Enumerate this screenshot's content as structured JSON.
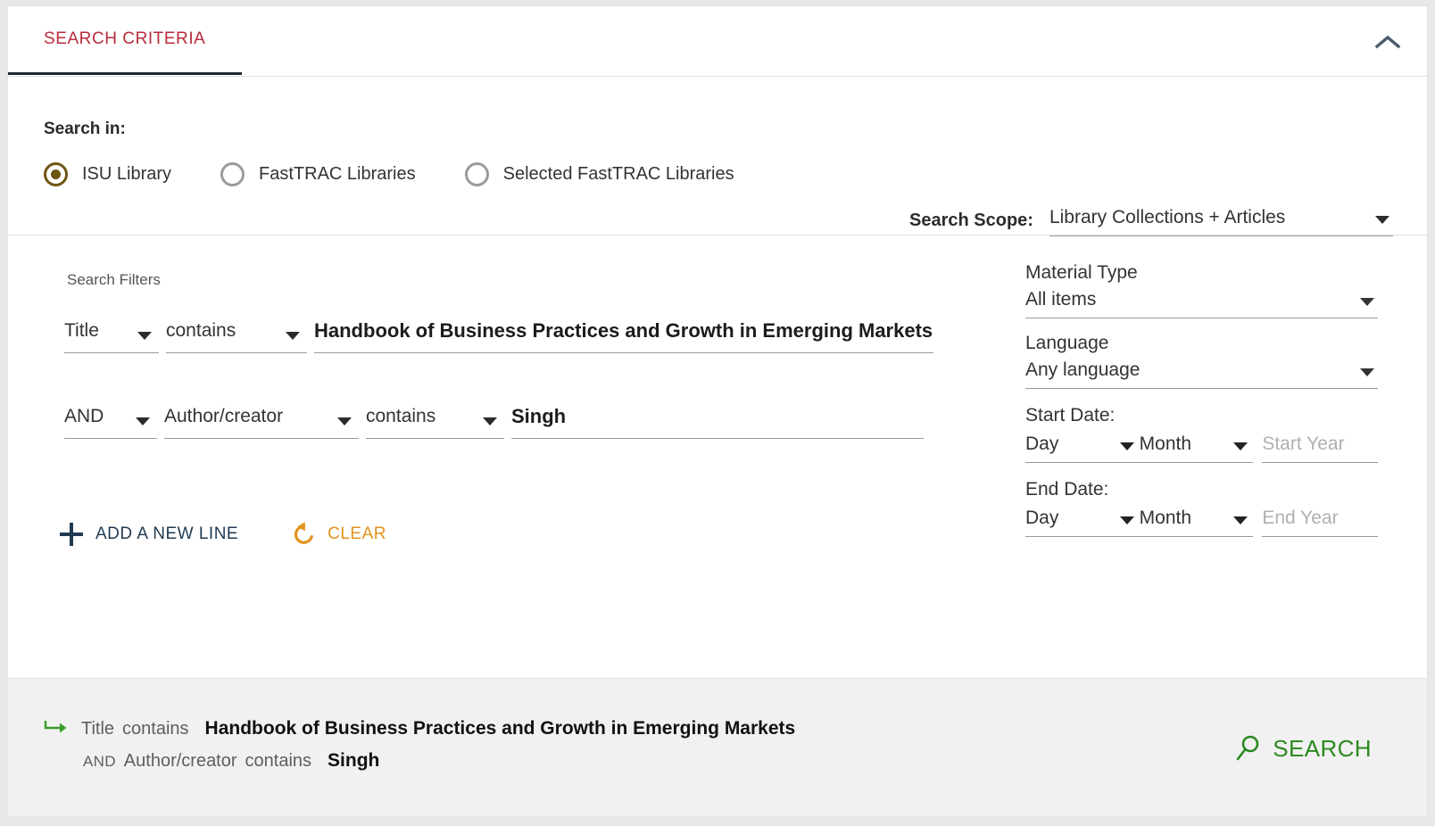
{
  "header": {
    "tab_label": "SEARCH CRITERIA",
    "collapse_icon": "chevron-up-icon",
    "accent_color": "#b92b3c",
    "tab_underline_color": "#1b2733"
  },
  "search_in": {
    "label": "Search in:",
    "options": [
      {
        "label": "ISU Library",
        "selected": true
      },
      {
        "label": "FastTRAC Libraries",
        "selected": false
      },
      {
        "label": "Selected FastTRAC Libraries",
        "selected": false
      }
    ],
    "selected_color": "#6e5612"
  },
  "search_scope": {
    "label": "Search Scope:",
    "value": "Library Collections + Articles",
    "caret_icon": "chevron-down-icon"
  },
  "filters": {
    "title": "Search Filters",
    "rows": [
      {
        "boolean": null,
        "field": "Title",
        "operator": "contains",
        "value": "Handbook of Business Practices and Growth in Emerging Markets"
      },
      {
        "boolean": "AND",
        "field": "Author/creator",
        "operator": "contains",
        "value": "Singh"
      }
    ],
    "add_line_label": "ADD A NEW LINE",
    "add_line_icon": "plus-icon",
    "add_line_color": "#1f3a52",
    "clear_label": "CLEAR",
    "clear_icon": "rotate-ccw-icon",
    "clear_color": "#e3921c"
  },
  "facets": {
    "material_type_label": "Material Type",
    "material_type_value": "All items",
    "language_label": "Language",
    "language_value": "Any language",
    "start_date_label": "Start Date:",
    "start_day": "Day",
    "start_month": "Month",
    "start_year_placeholder": "Start Year",
    "start_year_value": "",
    "end_date_label": "End Date:",
    "end_day": "Day",
    "end_month": "Month",
    "end_year_placeholder": "End Year",
    "end_year_value": ""
  },
  "summary": {
    "arrow_icon": "arrow-turn-right-icon",
    "arrow_color": "#3a9e2a",
    "line1": {
      "field": "Title",
      "operator": "contains",
      "value": "Handbook of Business Practices and Growth in Emerging Markets"
    },
    "line2": {
      "boolean": "AND",
      "field": "Author/creator",
      "operator": "contains",
      "value": "Singh"
    }
  },
  "search_button": {
    "label": "SEARCH",
    "icon": "magnifier-icon",
    "color": "#2d8a21"
  }
}
